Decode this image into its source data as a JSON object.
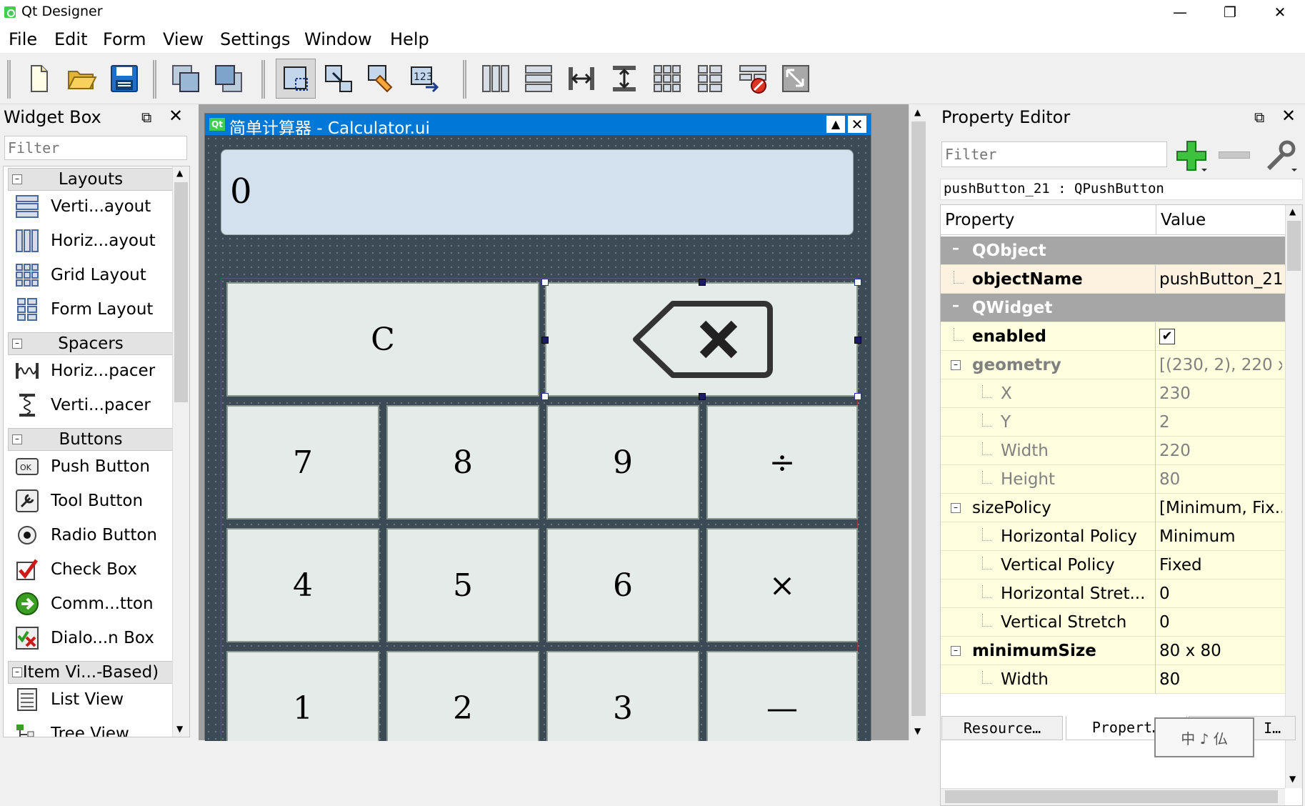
{
  "window": {
    "title": "Qt Designer",
    "minimize": "—",
    "maximize": "❐",
    "close": "✕"
  },
  "menu": [
    "File",
    "Edit",
    "Form",
    "View",
    "Settings",
    "Window",
    "Help"
  ],
  "widget_box": {
    "title": "Widget Box",
    "filter_placeholder": "Filter",
    "categories": [
      {
        "label": "Layouts",
        "items": [
          "Verti...ayout",
          "Horiz...ayout",
          "Grid Layout",
          "Form Layout"
        ]
      },
      {
        "label": "Spacers",
        "items": [
          "Horiz...pacer",
          "Verti...pacer"
        ]
      },
      {
        "label": "Buttons",
        "items": [
          "Push Button",
          "Tool Button",
          "Radio Button",
          "Check Box",
          "Comm...tton",
          "Dialo...n Box"
        ]
      },
      {
        "label": "Item Vi...-Based)",
        "items": [
          "List View",
          "Tree View"
        ]
      }
    ]
  },
  "subwindow": {
    "title": "简单计算器 - Calculator.ui",
    "qt_badge": "Qt"
  },
  "calculator": {
    "display": "0",
    "clear": "C",
    "row1": [
      "7",
      "8",
      "9",
      "÷"
    ],
    "row2": [
      "4",
      "5",
      "6",
      "×"
    ],
    "row3": [
      "1",
      "2",
      "3",
      "—"
    ]
  },
  "property_editor": {
    "title": "Property Editor",
    "filter_placeholder": "Filter",
    "object_label": "pushButton_21 : QPushButton",
    "col_property": "Property",
    "col_value": "Value",
    "rows": [
      {
        "name": "QObject",
        "value": ""
      },
      {
        "name": "objectName",
        "value": "pushButton_21"
      },
      {
        "name": "QWidget",
        "value": ""
      },
      {
        "name": "enabled",
        "value": "✔"
      },
      {
        "name": "geometry",
        "value": "[(230, 2), 220 x..."
      },
      {
        "name": "X",
        "value": "230"
      },
      {
        "name": "Y",
        "value": "2"
      },
      {
        "name": "Width",
        "value": "220"
      },
      {
        "name": "Height",
        "value": "80"
      },
      {
        "name": "sizePolicy",
        "value": "[Minimum, Fix..."
      },
      {
        "name": "Horizontal Policy",
        "value": "Minimum"
      },
      {
        "name": "Vertical Policy",
        "value": "Fixed"
      },
      {
        "name": "Horizontal Stret...",
        "value": "0"
      },
      {
        "name": "Vertical Stretch",
        "value": "0"
      },
      {
        "name": "minimumSize",
        "value": "80 x 80"
      },
      {
        "name": "Width",
        "value": "80"
      }
    ],
    "tabs": [
      "Resource…",
      "Propert…",
      "Object I…"
    ],
    "ime": "中 ♪ 仏"
  },
  "colors": {
    "accent": "#0078d7",
    "group_header": "#a6a6a6",
    "property_bg": "#ffffe0",
    "form_bg": "#3c4a55",
    "display_bg": "#d3e0ee"
  }
}
